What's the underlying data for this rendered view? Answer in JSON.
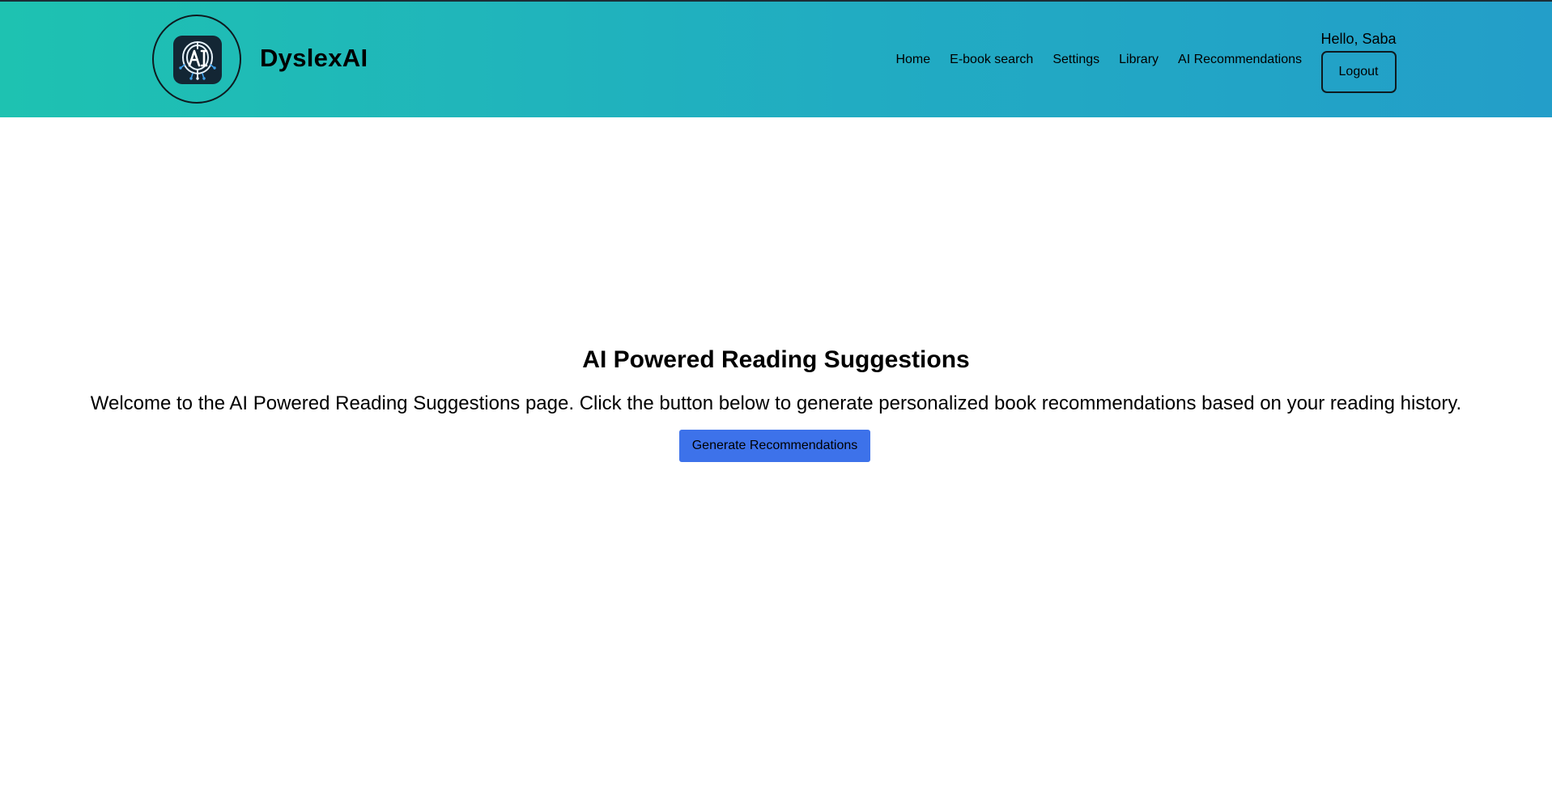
{
  "header": {
    "brand": "DyslexAI",
    "logo_icon": "ai-brain-circuit-icon",
    "nav": [
      {
        "label": "Home"
      },
      {
        "label": "E-book search"
      },
      {
        "label": "Settings"
      },
      {
        "label": "Library"
      },
      {
        "label": "AI Recommendations"
      }
    ],
    "greeting": "Hello, Saba",
    "logout_label": "Logout"
  },
  "main": {
    "title": "AI Powered Reading Suggestions",
    "intro": "Welcome to the AI Powered Reading Suggestions page. Click the button below to generate personalized book recommendations based on your reading history.",
    "generate_label": "Generate Recommendations"
  },
  "colors": {
    "header_gradient_start": "#1ec2b1",
    "header_gradient_end": "#239ec9",
    "button_blue": "#3d72ea",
    "logo_tile": "#132634"
  }
}
